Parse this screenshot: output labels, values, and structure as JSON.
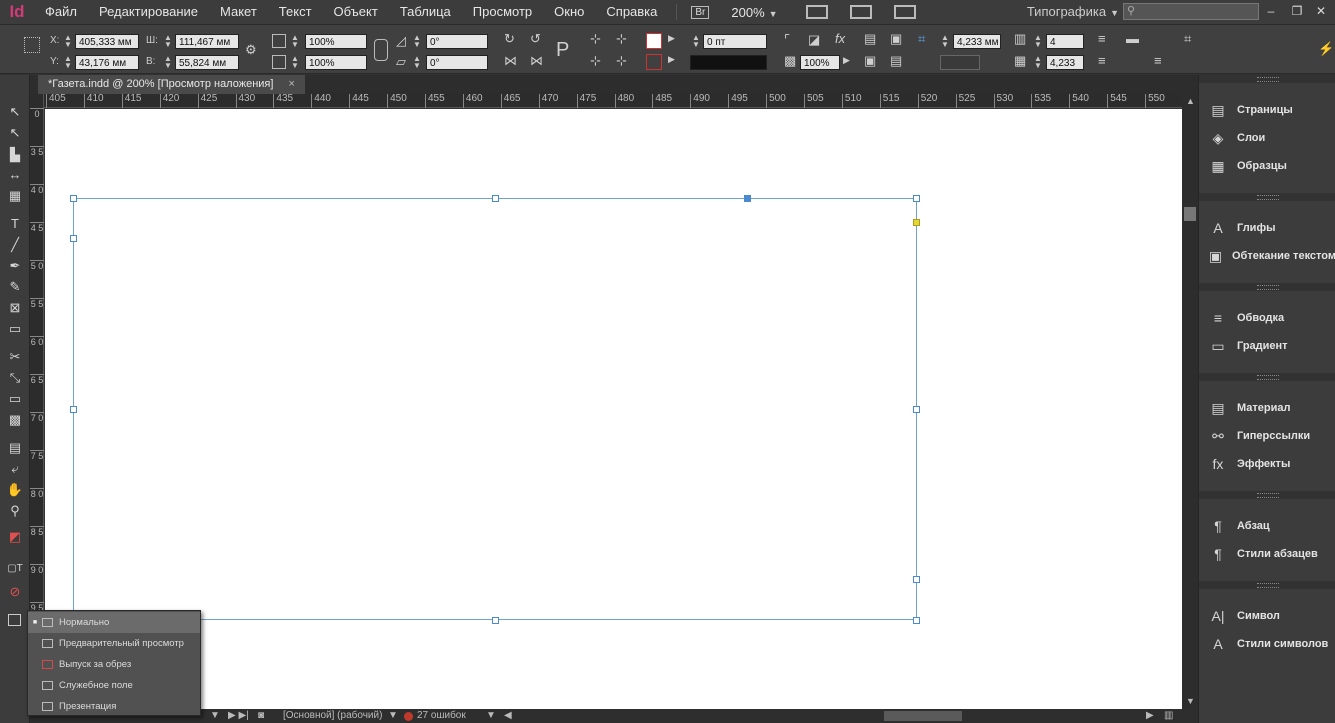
{
  "app": {
    "logo": "Id"
  },
  "menubar": {
    "items": [
      "Файл",
      "Редактирование",
      "Макет",
      "Текст",
      "Объект",
      "Таблица",
      "Просмотр",
      "Окно",
      "Справка"
    ],
    "bridge": "Br",
    "zoom": "200%",
    "workspace": "Типографика",
    "window_min": "–",
    "window_restore": "❐",
    "window_close": "✕"
  },
  "control_panel": {
    "x_label": "X:",
    "x_value": "405,333 мм",
    "y_label": "Y:",
    "y_value": "43,176 мм",
    "w_label": "Ш:",
    "w_value": "111,467 мм",
    "h_label": "В:",
    "h_value": "55,824 мм",
    "scale_x": "100%",
    "scale_y": "100%",
    "rotate": "0°",
    "shear": "0°",
    "stroke_weight": "0 пт",
    "opacity": "100%",
    "offset_value": "4,233 мм",
    "columns": "4",
    "gutter": "4,233 мм"
  },
  "document": {
    "tab_title": "*Газета.indd @ 200% [Просмотр наложения]",
    "tab_close": "×"
  },
  "ruler": {
    "h_ticks": [
      "405",
      "410",
      "415",
      "420",
      "425",
      "430",
      "435",
      "440",
      "445",
      "450",
      "455",
      "460",
      "465",
      "470",
      "475",
      "480",
      "485",
      "490",
      "495",
      "500",
      "505",
      "510",
      "515",
      "520",
      "525",
      "530",
      "535",
      "540",
      "545",
      "550"
    ],
    "v_ticks": [
      "0",
      "3 5",
      "4 0",
      "4 5",
      "5 0",
      "5 5",
      "6 0",
      "6 5",
      "7 0",
      "7 5",
      "8 0",
      "8 5",
      "9 0",
      "9 5"
    ]
  },
  "panels": [
    {
      "icon": "pages-icon",
      "glyph": "▤",
      "label": "Страницы"
    },
    {
      "icon": "layers-icon",
      "glyph": "◈",
      "label": "Слои"
    },
    {
      "icon": "swatches-icon",
      "glyph": "▦",
      "label": "Образцы"
    },
    {
      "icon": "glyphs-icon",
      "glyph": "A",
      "label": "Глифы"
    },
    {
      "icon": "text-wrap-icon",
      "glyph": "▣",
      "label": "Обтекание текстом"
    },
    {
      "icon": "stroke-icon",
      "glyph": "≡",
      "label": "Обводка"
    },
    {
      "icon": "gradient-icon",
      "glyph": "▭",
      "label": "Градиент"
    },
    {
      "icon": "material-icon",
      "glyph": "▤",
      "label": "Материал"
    },
    {
      "icon": "hyperlinks-icon",
      "glyph": "⚯",
      "label": "Гиперссылки"
    },
    {
      "icon": "effects-icon",
      "glyph": "fx",
      "label": "Эффекты"
    },
    {
      "icon": "paragraph-icon",
      "glyph": "¶",
      "label": "Абзац"
    },
    {
      "icon": "paragraph-styles-icon",
      "glyph": "¶",
      "label": "Стили абзацев"
    },
    {
      "icon": "character-icon",
      "glyph": "A|",
      "label": "Символ"
    },
    {
      "icon": "character-styles-icon",
      "glyph": "A",
      "label": "Стили символов"
    }
  ],
  "status_bar": {
    "style": "[Основной] (рабочий)",
    "errors": "27 ошибок"
  },
  "screen_mode_menu": {
    "items": [
      {
        "label": "Нормально",
        "active": true
      },
      {
        "label": "Предварительный просмотр",
        "active": false
      },
      {
        "label": "Выпуск за обрез",
        "active": false
      },
      {
        "label": "Служебное поле",
        "active": false
      },
      {
        "label": "Презентация",
        "active": false
      }
    ]
  },
  "colors": {
    "accent": "#4a8bd0",
    "logo": "#d03b78",
    "error": "#c0392b",
    "canvas": "#ffffff",
    "ui_dark": "#323232"
  }
}
